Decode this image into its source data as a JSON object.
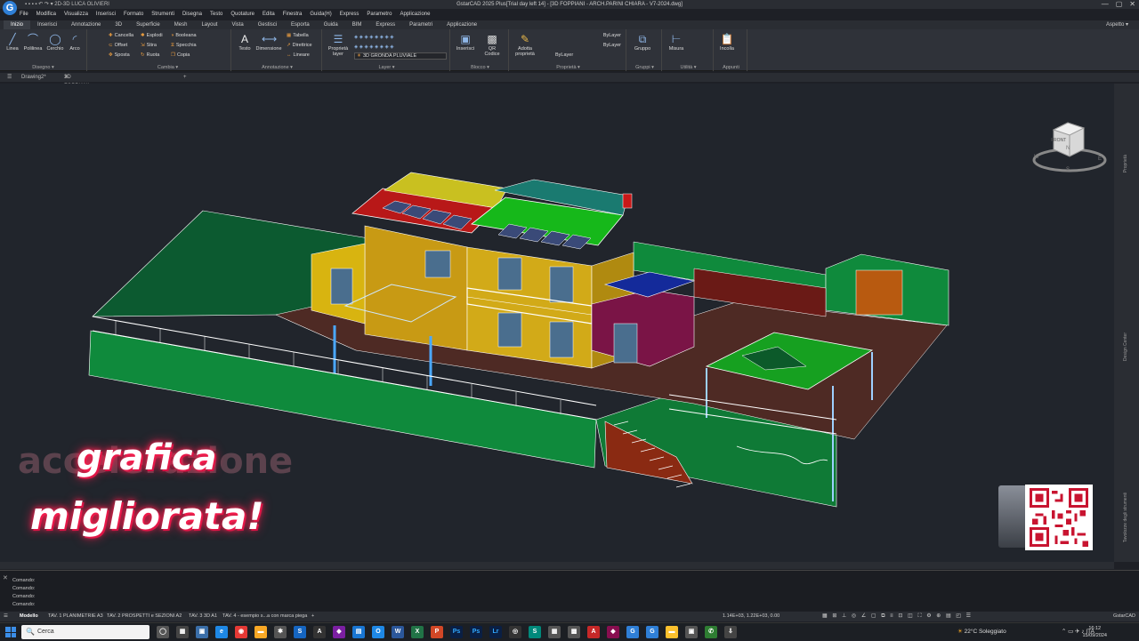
{
  "window": {
    "title": "GstarCAD 2025 Plus[Trial day left 14] - [3D FOPPIANI - ARCH.PARINI CHIARA - V7-2024.dwg]",
    "quick_access": "2D-3D LUCA OLIVIERI",
    "controls": [
      "—",
      "▢",
      "✕"
    ]
  },
  "menubar": [
    "File",
    "Modifica",
    "Visualizza",
    "Inserisci",
    "Formato",
    "Strumenti",
    "Disegna",
    "Testo",
    "Quotature",
    "Edita",
    "Finestra",
    "Guida(H)",
    "Express",
    "Parametro",
    "Applicazione"
  ],
  "ribbon_tabs": [
    "Inizio",
    "Inserisci",
    "Annotazione",
    "3D",
    "Superficie",
    "Mesh",
    "Layout",
    "Vista",
    "Gestisci",
    "Esporta",
    "Guida",
    "BIM",
    "Express",
    "Parametri",
    "Applicazione"
  ],
  "ribbon_active_tab": "Inizio",
  "aspetto": "Aspetto ▾",
  "ribbon": {
    "disegno": {
      "title": "Disegno ▾",
      "tools": [
        "Linea",
        "Polilinea",
        "Cerchio",
        "Arco"
      ]
    },
    "cambia": {
      "title": "Cambia ▾",
      "tools": [
        "Cancella",
        "Esplodi",
        "Booleana",
        "Offset",
        "Stira",
        "Specchia",
        "Sposta",
        "Ruota",
        "Copia"
      ]
    },
    "annotazione": {
      "title": "Annotazione ▾",
      "tools": [
        "Testo",
        "Dimensione",
        "Tabella",
        "Direttrice",
        "Lineare"
      ]
    },
    "layer": {
      "title": "Layer ▾",
      "tools": [
        "Proprietà layer"
      ],
      "current_layer": "3D GRONDA PLUVIALE"
    },
    "blocco": {
      "title": "Blocco ▾",
      "tools": [
        "Inserisci",
        "QR Codice"
      ]
    },
    "proprieta": {
      "title": "Proprietà ▾",
      "tools": [
        "Adotta proprietà"
      ],
      "values": [
        "ByLayer",
        "ByLayer",
        "ByLayer"
      ]
    },
    "gruppi": {
      "title": "Gruppi ▾",
      "tools": [
        "Gruppo"
      ]
    },
    "utilita": {
      "title": "Utilità ▾",
      "tools": [
        "Misura"
      ]
    },
    "appunti": {
      "title": "Appunti",
      "tools": [
        "Incolla"
      ]
    }
  },
  "doc_tabs": [
    "Drawing2*",
    "3D FOPPIANI - ARCH.P...NI CHIARA - V7-2024*"
  ],
  "viewcube": {
    "face": "FRONT",
    "compass": [
      "N",
      "E",
      "S",
      "W"
    ]
  },
  "side_panels": [
    "Proprietà",
    "Design Center",
    "Tavolozze degli strumenti"
  ],
  "overlay": {
    "ghost_text": "accelerazione",
    "line1": "grafica",
    "line2": "migliorata!"
  },
  "command_lines": [
    "Comando:",
    "Comando:",
    "Comando:",
    "Comando:"
  ],
  "layout_tabs": [
    "Modello",
    "TAV. 1 PLANIMETRIE A3",
    "TAV. 2 PROSPETTI e SEZIONI A2",
    "TAV. 3 3D A1",
    "TAV. 4 - esempio s...a con marca piega",
    "+"
  ],
  "coordinates": "1.14E+03, 1.22E+03, 0.00",
  "statusbar_right": "GstarCAD",
  "taskbar": {
    "search_placeholder": "Cerca",
    "weather": "22°C Soleggiato",
    "time": "16:12",
    "date": "15/09/2024"
  },
  "colors": {
    "accent": "#2f7fd6",
    "canvas": "#21252c",
    "ribbon": "#2f3239"
  }
}
